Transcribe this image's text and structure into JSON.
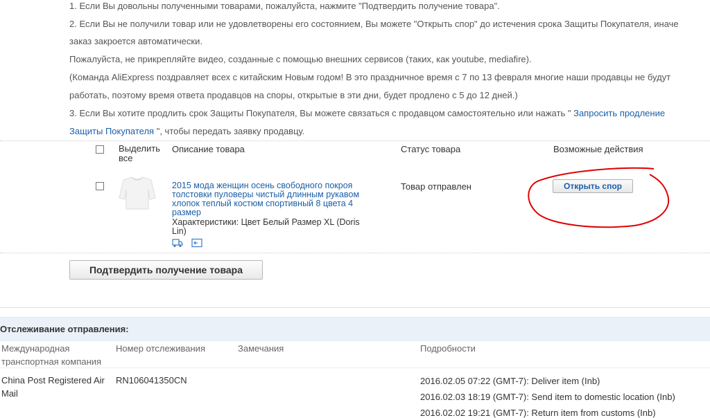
{
  "notes": {
    "line1": "1. Если Вы довольны полученными товарами, пожалуйста, нажмите \"Подтвердить получение товара\".",
    "line2a": "2. Если Вы не получили товар или не удовлетворены его состоянием, Вы можете \"Открыть спор\" до истечения срока Защиты Покупателя, иначе",
    "line2b": "заказ закроется автоматически.",
    "line3": "Пожалуйста, не прикрепляйте видео, созданные с помощью внешних сервисов (таких, как youtube, mediafire).",
    "line4a": "(Команда AliExpress поздравляет всех с китайским Новым годом! В это праздничное время с 7 по 13 февраля многие наши продавцы не будут",
    "line4b": "работать, поэтому время ответа продавцов на споры, открытые в эти дни, будет продлено с 5 до 12 дней.)",
    "line5_pre": "3. Если Вы хотите продлить срок Защиты Покупателя, Вы можете связаться с продавцом самостоятельно или нажать \"",
    "line5_link1": "Запросить продление",
    "line5_link2": "Защиты Покупателя",
    "line5_post": "\", чтобы передать заявку продавцу."
  },
  "order_table": {
    "select_all": "Выделить все",
    "col_description": "Описание товара",
    "col_status": "Статус товара",
    "col_actions": "Возможные действия",
    "item": {
      "title": "2015 мода женщин осень свободного покроя толстовки пуловеры чистый длинным рукавом хлопок теплый костюм спортивный 8 цвета 4 размер",
      "specs": "Характеристики: Цвет Белый Размер XL (Doris Lin)",
      "status": "Товар отправлен",
      "action_label": "Открыть спор",
      "icons": [
        "truck-icon",
        "message-icon"
      ]
    }
  },
  "confirm_button": "Подтвердить получение товара",
  "tracking": {
    "title": "Отслеживание отправления:",
    "headers": {
      "carrier": "Международная транспортная компания",
      "number": "Номер отслеживания",
      "remarks": "Замечания",
      "details": "Подробности"
    },
    "row": {
      "carrier": "China Post Registered Air Mail",
      "number": "RN106041350CN",
      "remarks": "",
      "events": [
        "2016.02.05 07:22 (GMT-7): Deliver item (Inb)",
        "2016.02.03 18:19 (GMT-7): Send item to domestic location (Inb)",
        "2016.02.02 19:21 (GMT-7): Return item from customs (Inb)"
      ]
    }
  },
  "colors": {
    "link": "#1a5fa8",
    "annotation": "#e00000",
    "tracking_bar": "#eaf1f8"
  }
}
